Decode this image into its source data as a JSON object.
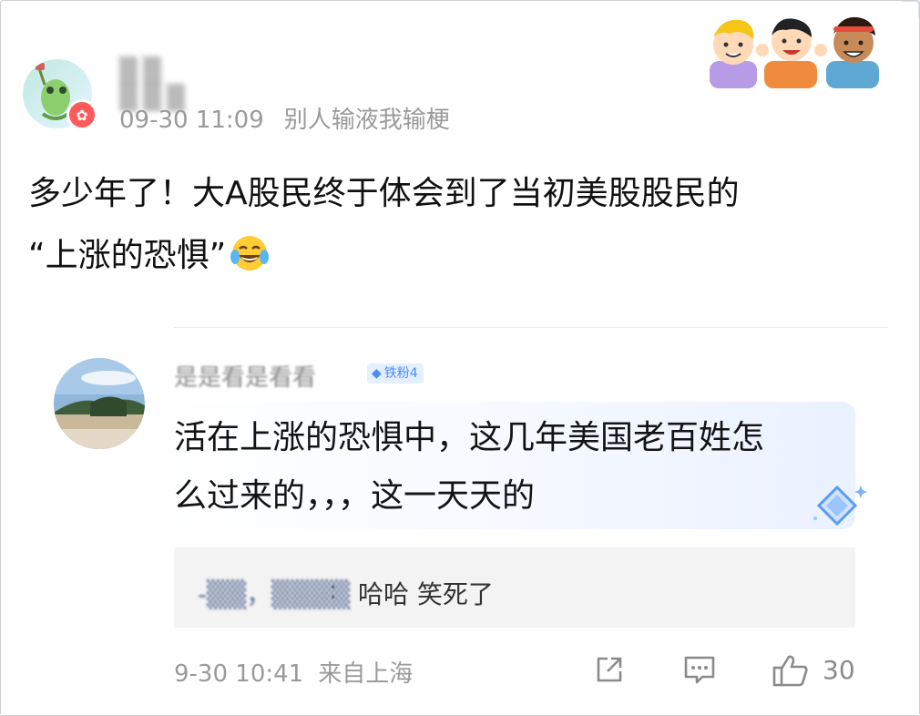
{
  "post": {
    "author": "▒▒ ▒▒▒",
    "date": "09-30 11:09",
    "source": "别人输液我输梗",
    "body_line1": "多少年了！大A股民终于体会到了当初美股股民的",
    "body_line2": "“上涨的恐惧”",
    "emoji": "laughing-tears-emoji"
  },
  "reply": {
    "author": "是是看是看看",
    "fan_badge": "铁粉4",
    "text_line1": "活在上涨的恐惧中，这几年美国老百姓怎",
    "text_line2": "么过来的，，，这一天天的",
    "sub_reply": {
      "author": "-▒▒，▒▒▒▒",
      "separator": ":",
      "text": "哈哈 笑死了"
    },
    "date": "9-30 10:41",
    "location": "来自上海",
    "like_count": "30"
  },
  "icons": {
    "share": "share-icon",
    "comment": "comment-icon",
    "like": "thumbs-up-icon"
  },
  "colors": {
    "meta_gray": "#9a9a9a",
    "badge_blue": "#4d8cf5",
    "sub_reply_user": "#5c6f96"
  }
}
